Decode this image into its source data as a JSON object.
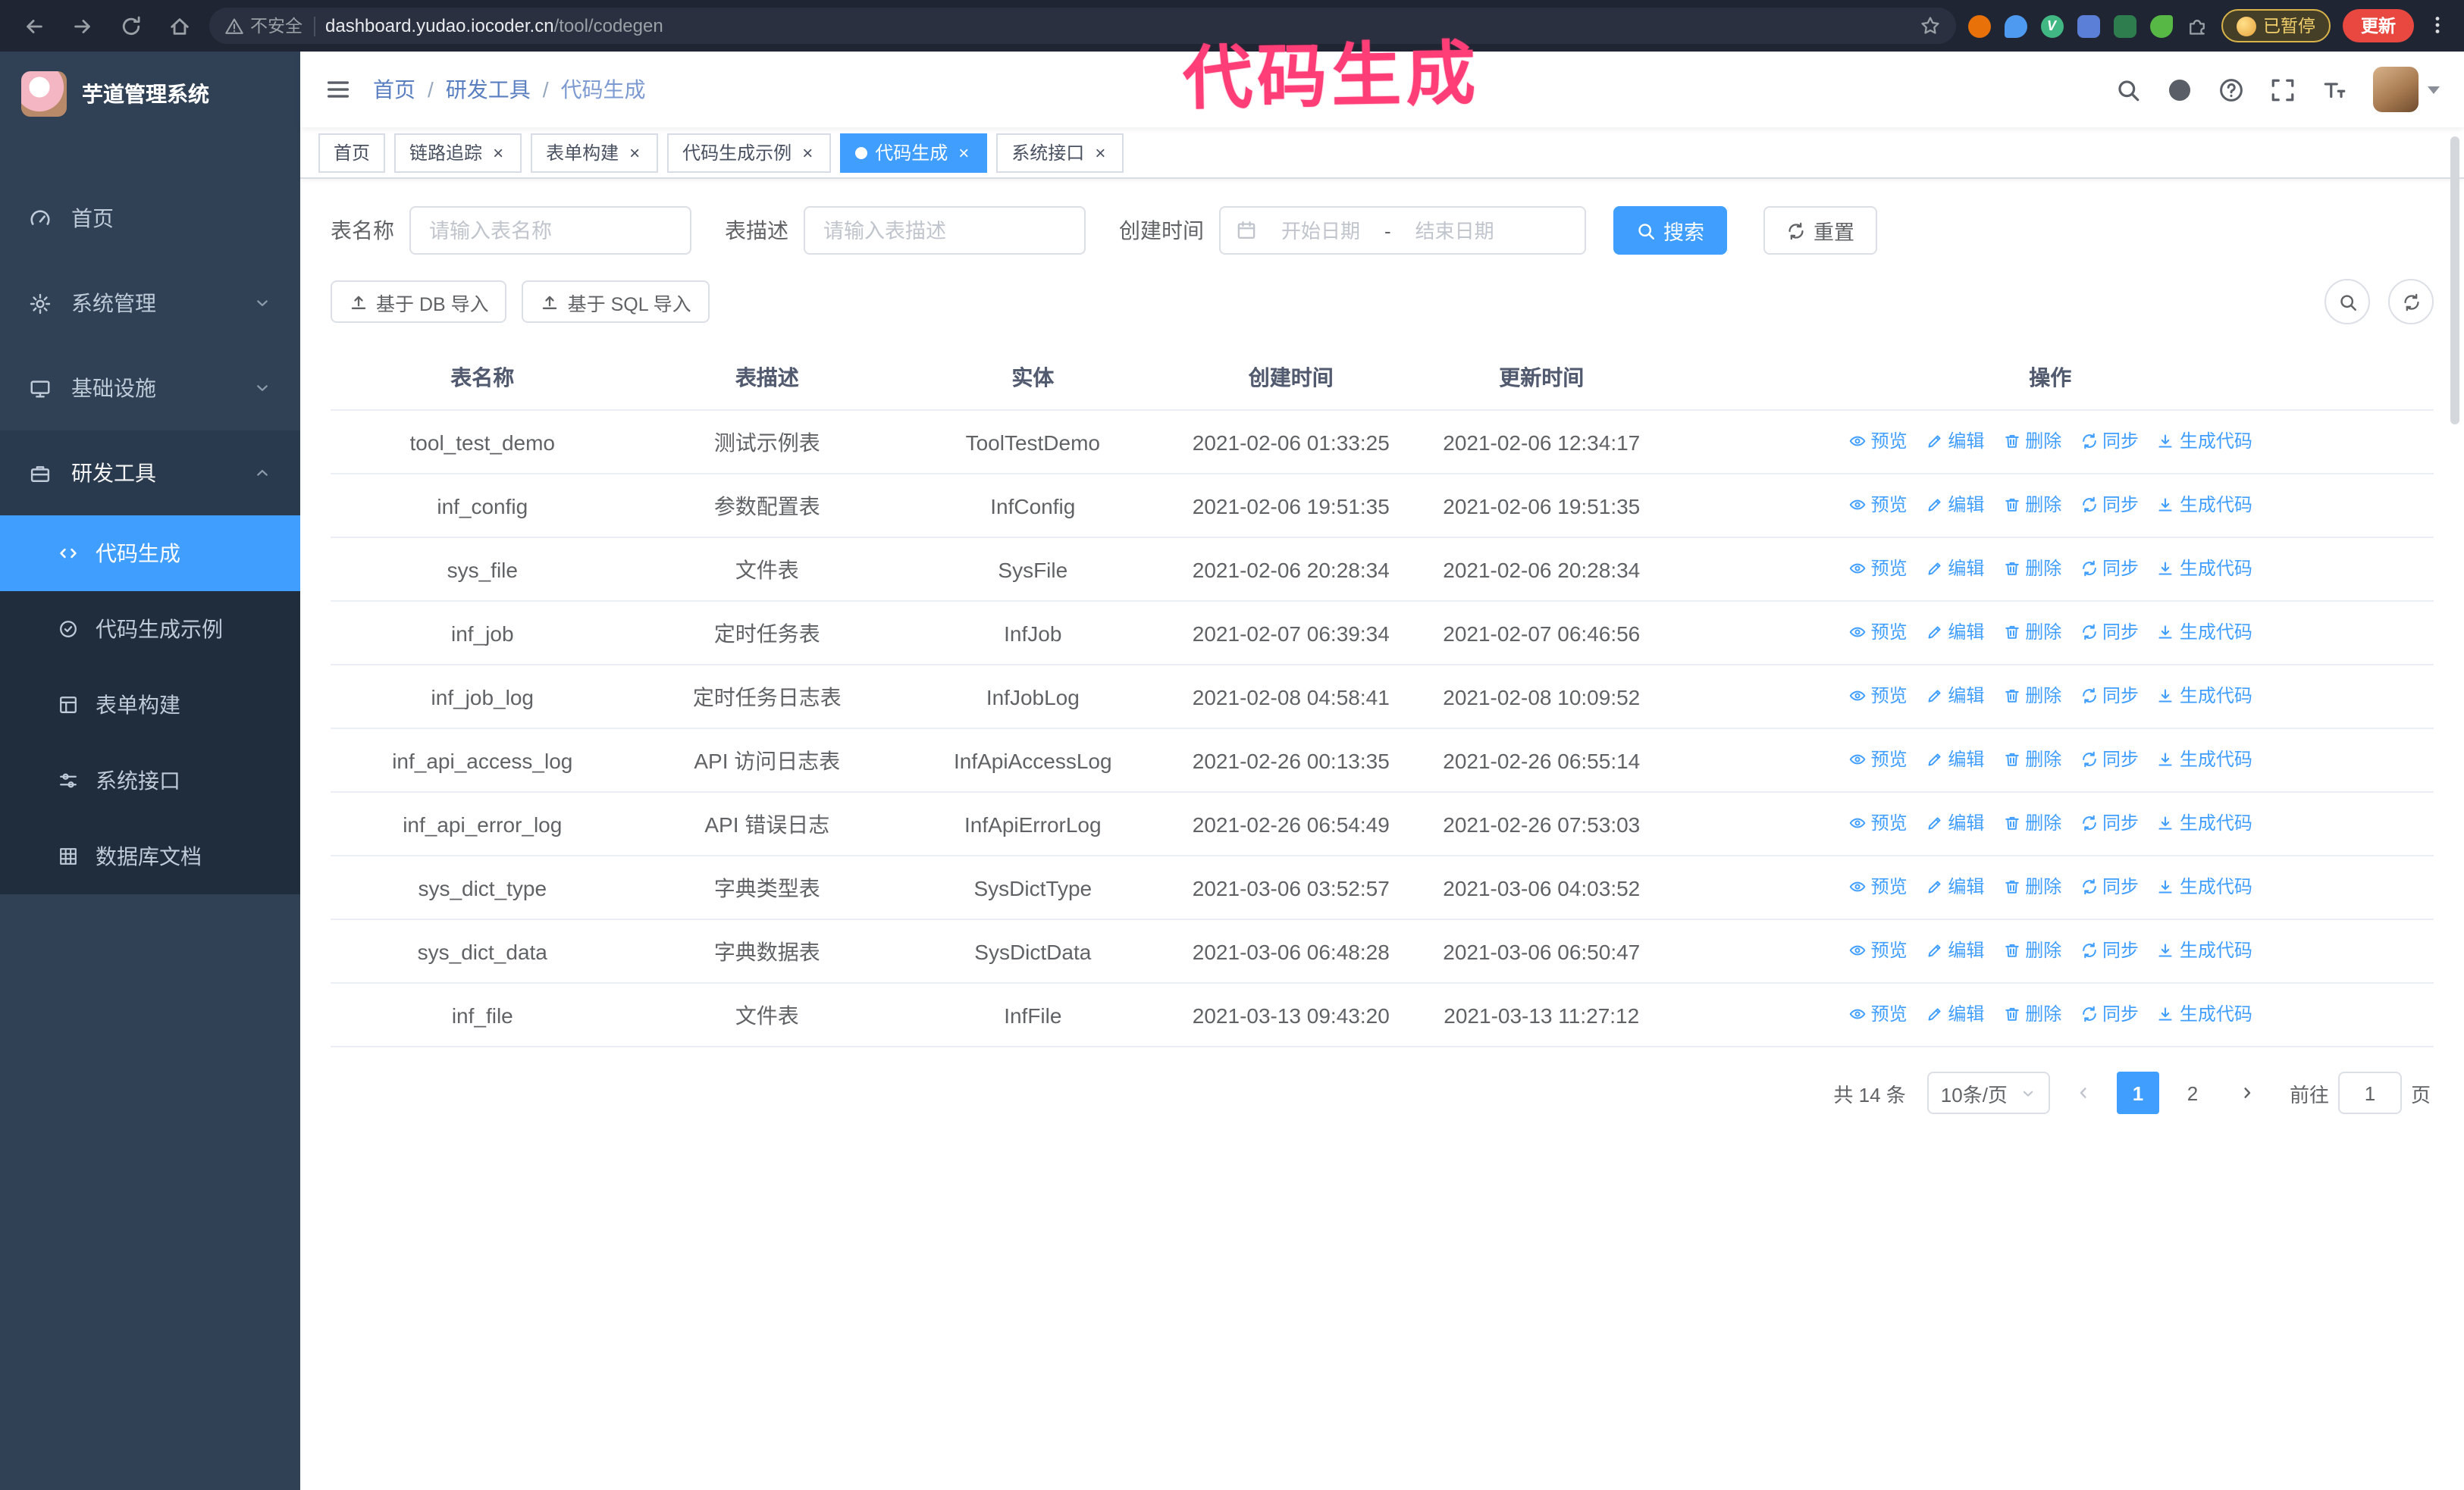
{
  "annotation": {
    "text": "代码生成"
  },
  "browser": {
    "security_label": "不安全",
    "url_host": "dashboard.yudao.iocoder.cn",
    "url_path": "/tool/codegen",
    "extension_letter": "V",
    "paused_badge": "已暂停",
    "update_label": "更新"
  },
  "ui": {
    "close_glyph": "×",
    "breadcrumb_separator": "/"
  },
  "sidebar": {
    "app_title": "芋道管理系统",
    "menu": [
      {
        "label": "首页"
      },
      {
        "label": "系统管理"
      },
      {
        "label": "基础设施"
      },
      {
        "label": "研发工具"
      }
    ],
    "submenu": [
      {
        "label": "代码生成"
      },
      {
        "label": "代码生成示例"
      },
      {
        "label": "表单构建"
      },
      {
        "label": "系统接口"
      },
      {
        "label": "数据库文档"
      }
    ]
  },
  "header": {
    "breadcrumb": {
      "home": "首页",
      "section": "研发工具",
      "current": "代码生成"
    }
  },
  "tabs": [
    {
      "label": "首页"
    },
    {
      "label": "链路追踪"
    },
    {
      "label": "表单构建"
    },
    {
      "label": "代码生成示例"
    },
    {
      "label": "代码生成"
    },
    {
      "label": "系统接口"
    }
  ],
  "filters": {
    "name_label": "表名称",
    "name_placeholder": "请输入表名称",
    "desc_label": "表描述",
    "desc_placeholder": "请输入表描述",
    "time_label": "创建时间",
    "start_placeholder": "开始日期",
    "range_separator": "-",
    "end_placeholder": "结束日期",
    "search_label": "搜索",
    "reset_label": "重置"
  },
  "toolbar": {
    "import_db_label": "基于 DB 导入",
    "import_sql_label": "基于 SQL 导入"
  },
  "table": {
    "columns": [
      "表名称",
      "表描述",
      "实体",
      "创建时间",
      "更新时间",
      "操作"
    ],
    "row_actions": [
      "预览",
      "编辑",
      "删除",
      "同步",
      "生成代码"
    ],
    "rows": [
      {
        "name": "tool_test_demo",
        "desc": "测试示例表",
        "entity": "ToolTestDemo",
        "create_time": "2021-02-06 01:33:25",
        "update_time": "2021-02-06 12:34:17"
      },
      {
        "name": "inf_config",
        "desc": "参数配置表",
        "entity": "InfConfig",
        "create_time": "2021-02-06 19:51:35",
        "update_time": "2021-02-06 19:51:35"
      },
      {
        "name": "sys_file",
        "desc": "文件表",
        "entity": "SysFile",
        "create_time": "2021-02-06 20:28:34",
        "update_time": "2021-02-06 20:28:34"
      },
      {
        "name": "inf_job",
        "desc": "定时任务表",
        "entity": "InfJob",
        "create_time": "2021-02-07 06:39:34",
        "update_time": "2021-02-07 06:46:56"
      },
      {
        "name": "inf_job_log",
        "desc": "定时任务日志表",
        "entity": "InfJobLog",
        "create_time": "2021-02-08 04:58:41",
        "update_time": "2021-02-08 10:09:52"
      },
      {
        "name": "inf_api_access_log",
        "desc": "API 访问日志表",
        "entity": "InfApiAccessLog",
        "create_time": "2021-02-26 00:13:35",
        "update_time": "2021-02-26 06:55:14"
      },
      {
        "name": "inf_api_error_log",
        "desc": "API 错误日志",
        "entity": "InfApiErrorLog",
        "create_time": "2021-02-26 06:54:49",
        "update_time": "2021-02-26 07:53:03"
      },
      {
        "name": "sys_dict_type",
        "desc": "字典类型表",
        "entity": "SysDictType",
        "create_time": "2021-03-06 03:52:57",
        "update_time": "2021-03-06 04:03:52"
      },
      {
        "name": "sys_dict_data",
        "desc": "字典数据表",
        "entity": "SysDictData",
        "create_time": "2021-03-06 06:48:28",
        "update_time": "2021-03-06 06:50:47"
      },
      {
        "name": "inf_file",
        "desc": "文件表",
        "entity": "InfFile",
        "create_time": "2021-03-13 09:43:20",
        "update_time": "2021-03-13 11:27:12"
      }
    ]
  },
  "pagination": {
    "total": "共 14 条",
    "page_size": "10条/页",
    "pages": [
      "1",
      "2"
    ],
    "goto_label": "前往",
    "goto_value": "1",
    "unit_label": "页"
  },
  "colors": {
    "primary": "#409eff",
    "sidebar_bg": "#304156",
    "submenu_bg": "#1f2d3d",
    "annotation": "#ff3e78"
  }
}
